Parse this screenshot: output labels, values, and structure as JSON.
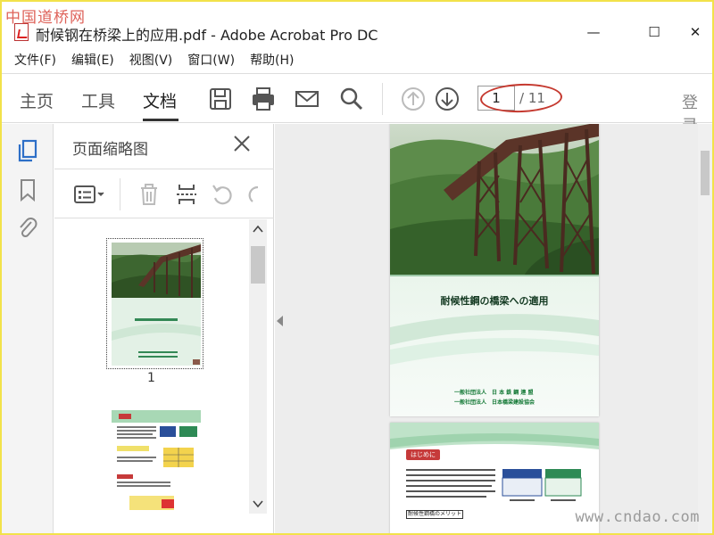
{
  "watermark": {
    "top": "中国道桥网",
    "bottom": "www.cndao.com"
  },
  "window": {
    "title": "耐候钢在桥梁上的应用.pdf - Adobe Acrobat Pro DC",
    "minimize": "—",
    "maximize": "☐",
    "close": "✕"
  },
  "menu": [
    "文件(F)",
    "编辑(E)",
    "视图(V)",
    "窗口(W)",
    "帮助(H)"
  ],
  "tabs": {
    "home": "主页",
    "tools": "工具",
    "document": "文档",
    "active": "document"
  },
  "navigation": {
    "current_page": "1",
    "total": "/ 11"
  },
  "login": "登录",
  "sidebar": {
    "title": "页面缩略图",
    "thumbnail_number": "1"
  },
  "document": {
    "cover_title": "耐候性鋼の橋梁への適用",
    "publisher_1": "一般社団法人　日 本 鉄 鋼 連 盟",
    "publisher_2": "一般社団法人　日本橋梁建設協会",
    "page2_heading": "はじめに",
    "page2_box": "耐候性鋼橋のメリット"
  },
  "colors": {
    "accent_red": "#c5392f",
    "active_blue": "#2d6fc7",
    "page_green": "#dcefe2"
  },
  "icons": {
    "toolbar": [
      "save-icon",
      "print-icon",
      "email-icon",
      "search-icon",
      "page-up-icon",
      "page-down-icon"
    ],
    "rail": [
      "thumbnails-icon",
      "bookmark-icon",
      "attachment-icon"
    ],
    "thumb_toolbar": [
      "options-menu-icon",
      "delete-icon",
      "extract-icon",
      "rotate-left-icon",
      "rotate-right-icon"
    ]
  }
}
